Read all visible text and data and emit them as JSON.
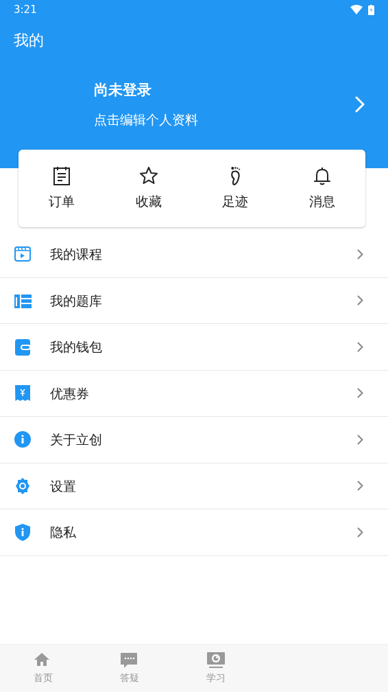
{
  "status_bar": {
    "time": "3:21"
  },
  "header": {
    "title": "我的"
  },
  "profile": {
    "name": "尚未登录",
    "subtitle": "点击编辑个人资料"
  },
  "shortcuts": [
    {
      "kind": "order",
      "label": "订单"
    },
    {
      "kind": "star",
      "label": "收藏"
    },
    {
      "kind": "foot",
      "label": "足迹"
    },
    {
      "kind": "bell",
      "label": "消息"
    }
  ],
  "menu": [
    {
      "kind": "video",
      "label": "我的课程"
    },
    {
      "kind": "bank",
      "label": "我的题库"
    },
    {
      "kind": "wallet",
      "label": "我的钱包"
    },
    {
      "kind": "coupon",
      "label": "优惠券"
    },
    {
      "kind": "info",
      "label": "关于立创"
    },
    {
      "kind": "gear",
      "label": "设置"
    },
    {
      "kind": "shield",
      "label": "隐私"
    }
  ],
  "tab_bar": [
    {
      "kind": "home",
      "label": "首页",
      "selected": false
    },
    {
      "kind": "chat",
      "label": "答疑",
      "selected": false
    },
    {
      "kind": "study",
      "label": "学习",
      "selected": false
    }
  ]
}
